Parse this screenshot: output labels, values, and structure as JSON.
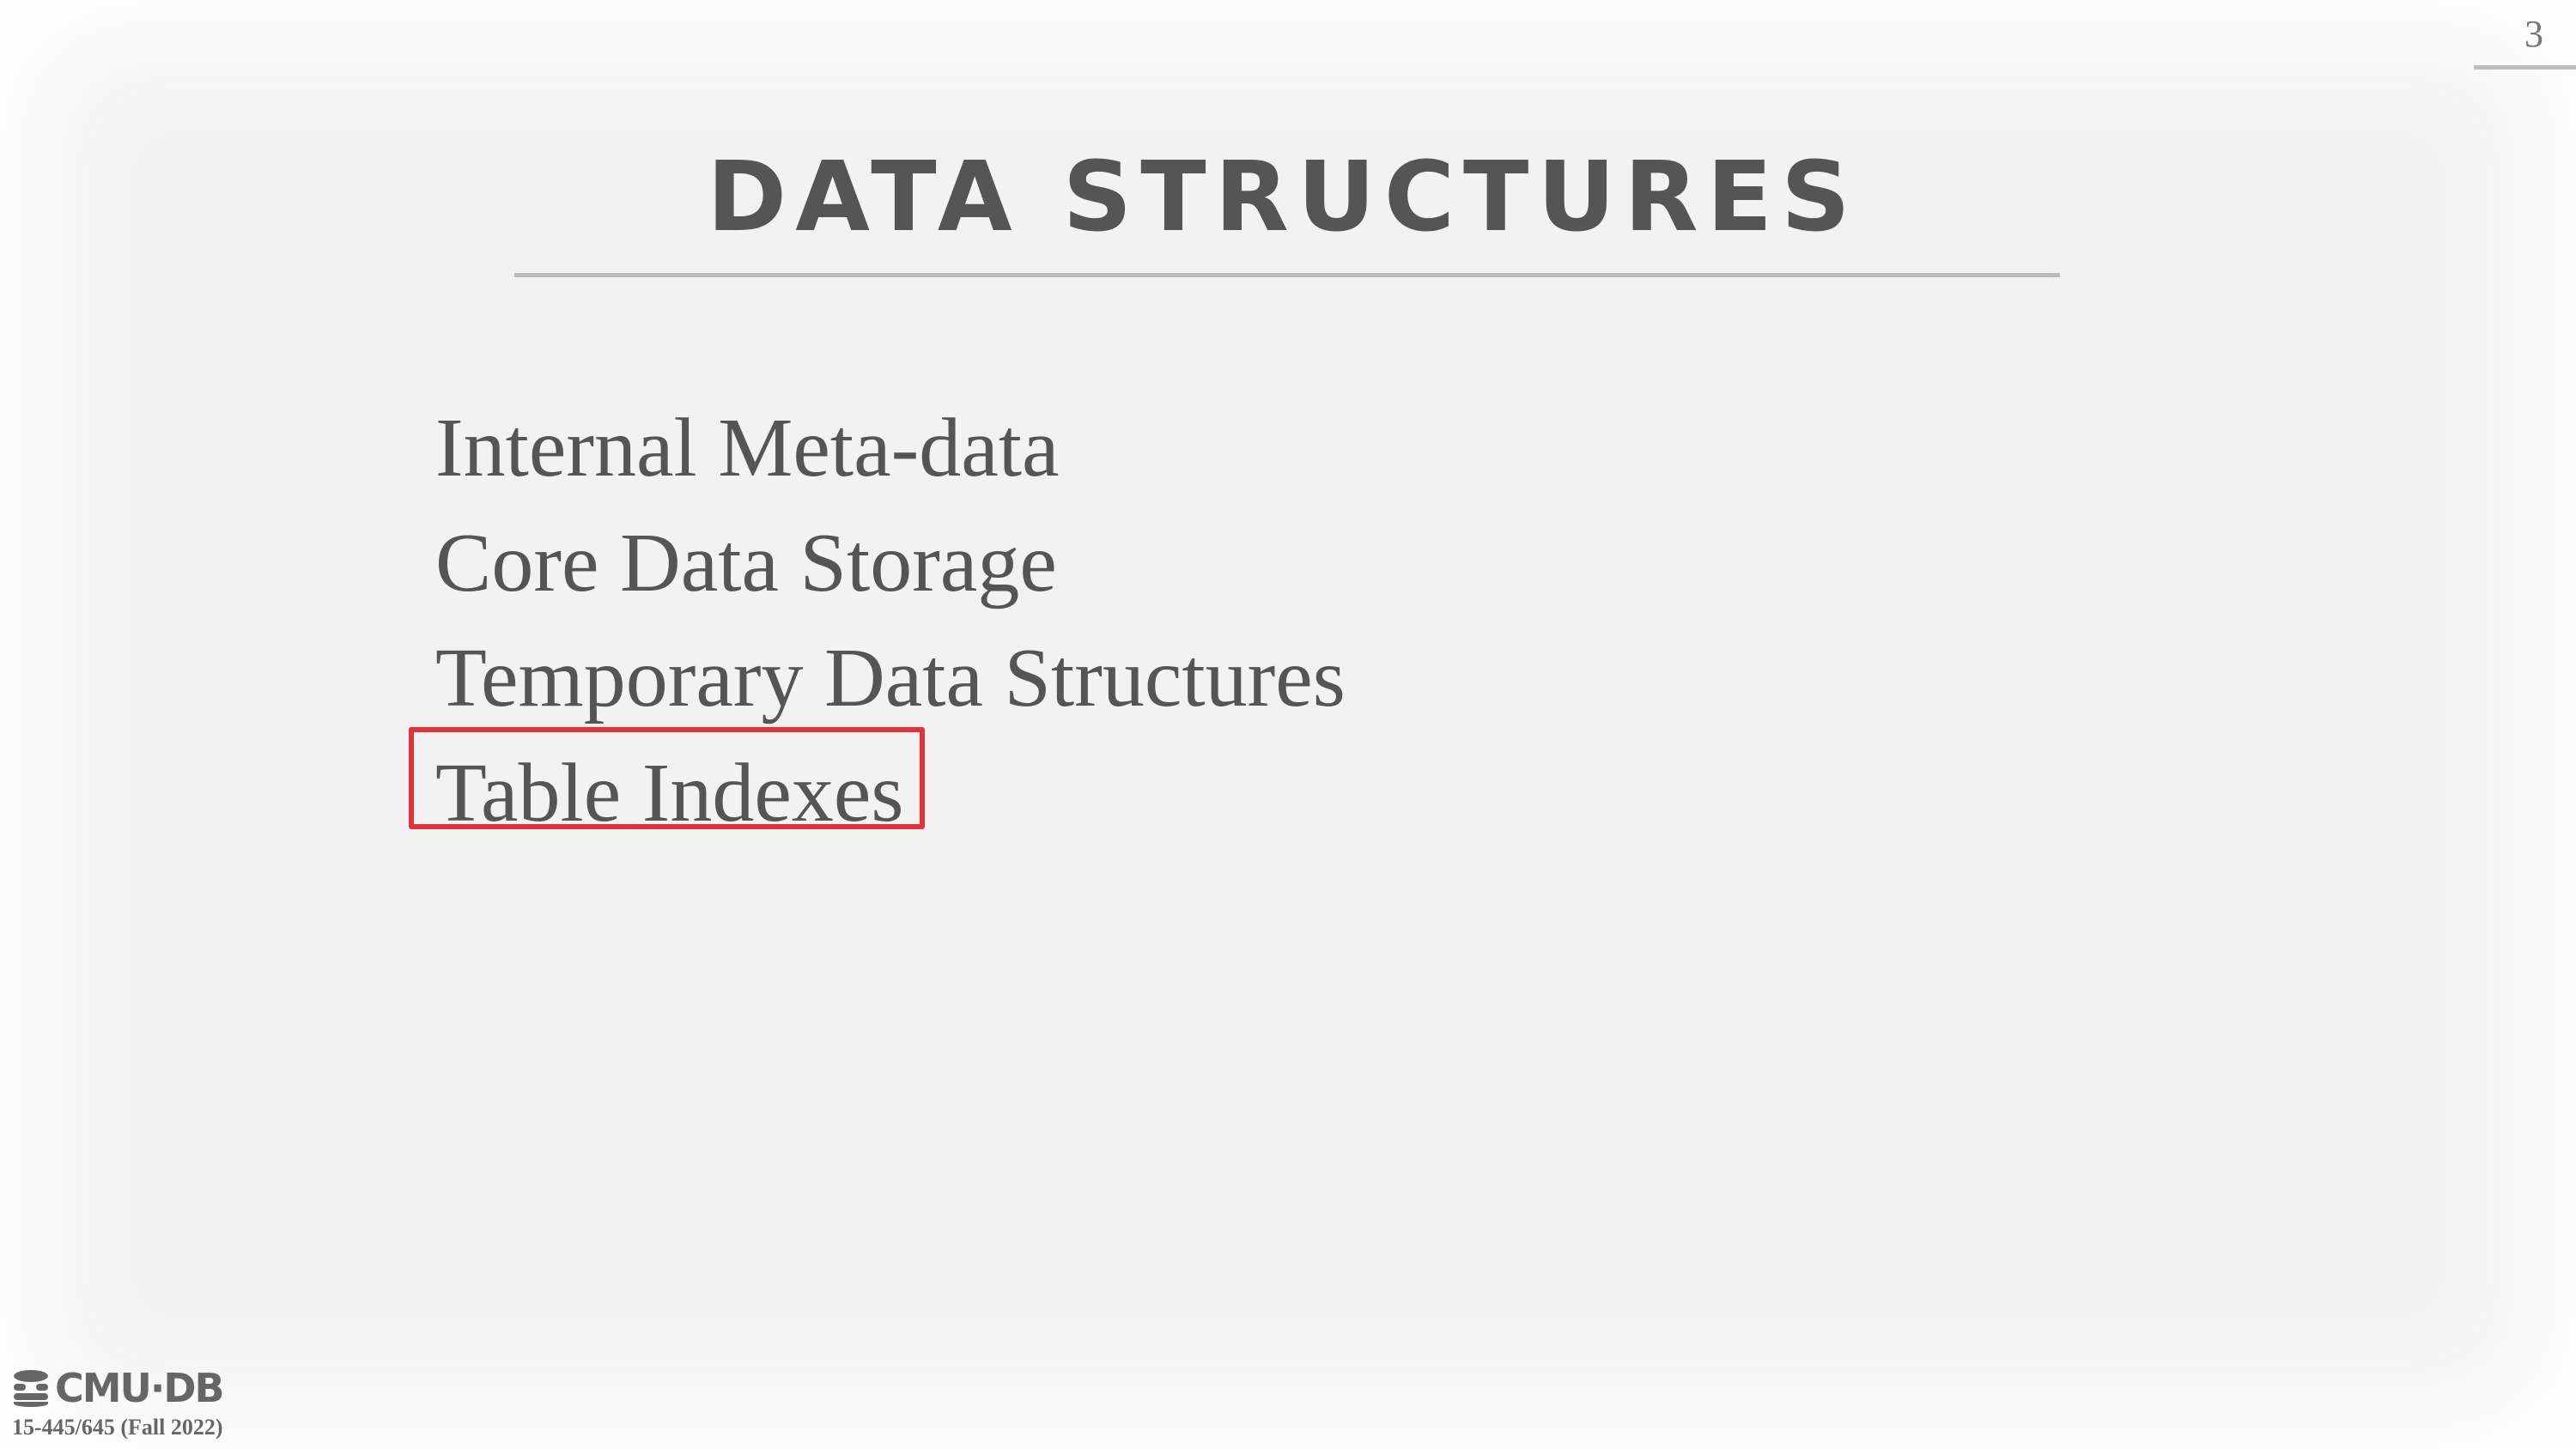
{
  "slide": {
    "page_number": "3",
    "title": "DATA STRUCTURES",
    "bullets": [
      "Internal Meta-data",
      "Core Data Storage",
      "Temporary Data Structures",
      "Table Indexes"
    ],
    "highlighted_bullet_index": 3,
    "highlight_color": "#e3323c"
  },
  "footer": {
    "logo_text": "CMU·DB",
    "logo_icon": "database-icon",
    "course": "15-445/645 (Fall 2022)"
  }
}
